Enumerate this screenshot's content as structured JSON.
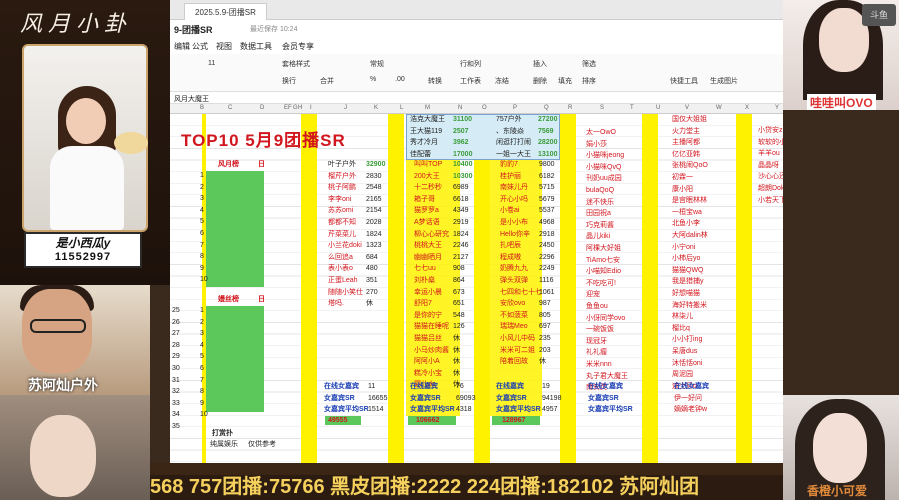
{
  "overlay": {
    "title_art": "风月小卦",
    "streamer_name": "是小西瓜y",
    "streamer_id": "11552997",
    "cam_left_label": "苏阿灿户外",
    "cam_right_label": "哇哇叫OVO",
    "cam_right2_label": "香橙小可爱",
    "corner_badge": "斗鱼",
    "ticker": "568  757团播:75766  黑皮团播:2222  224团播:182102   苏阿灿团"
  },
  "app": {
    "tab_title": "2025.5.9-团播SR",
    "file_name": "9-团播SR",
    "saved_status": "最近保存 10:24",
    "menu": [
      "编辑",
      "公式",
      "视图",
      "数据工具",
      "会员专享"
    ],
    "toolbar": {
      "font_size": "11",
      "items": [
        "套格样式",
        "换行",
        "合并",
        "常规",
        "转换",
        "行和列",
        "工作表",
        "冻结",
        "插入",
        "删除",
        "填充",
        "排序",
        "筛选",
        "快捷工具",
        "生成图片"
      ],
      "percent": "%",
      "decimals": ".00"
    },
    "formula_value": "风月大魔王"
  },
  "sheet": {
    "columns": [
      "B",
      "C",
      "D",
      "E",
      "F",
      "G",
      "H",
      "I",
      "J",
      "K",
      "L",
      "M",
      "N",
      "O",
      "P",
      "Q",
      "R",
      "S",
      "T",
      "U",
      "V",
      "W",
      "X",
      "Y"
    ],
    "title": "TOP10  5月9团播SR",
    "top_box": [
      [
        "浩克大魔王",
        "31100",
        "757户外",
        "27200"
      ],
      [
        "王大猫119",
        "2507",
        "、东陵焱",
        "7569"
      ],
      [
        "秀才冷月",
        "3962",
        "闲逛打打闹",
        "28200"
      ],
      [
        "佳配蕾",
        "17000",
        "一姐一大王",
        "13100"
      ]
    ],
    "section1_label": "风月榜",
    "section1_day": "日",
    "section2_label": "嫚丝榜",
    "section2_day": "日",
    "row_numbers1": [
      "1",
      "2",
      "3",
      "4",
      "5",
      "6",
      "7",
      "8",
      "9",
      "10"
    ],
    "row_numbers2": [
      "1",
      "2",
      "3",
      "4",
      "5",
      "6",
      "7",
      "8",
      "9",
      "10"
    ],
    "row_labels_left": [
      "25",
      "26",
      "27",
      "28",
      "29",
      "30",
      "31",
      "32",
      "33",
      "34",
      "35"
    ],
    "col_j": [
      [
        "叶子户外",
        "32900"
      ],
      [
        "榴芹户外",
        "2830"
      ],
      [
        "桃子阿鹏",
        "2548"
      ],
      [
        "李李oni",
        "2165"
      ],
      [
        "苏苏omi",
        "2154"
      ],
      [
        "都都不知",
        "2028"
      ],
      [
        "芹菜菜儿",
        "1824"
      ],
      [
        "小兰花doki",
        "1323"
      ],
      [
        "么回追a",
        "684"
      ],
      [
        "表小表o",
        "480"
      ],
      [
        "正蛋Leah",
        "351"
      ],
      [
        "随随小笑仕",
        "270"
      ],
      [
        "塔吗.",
        "休"
      ]
    ],
    "col_m": [
      [
        "叫叫TOP",
        "10400"
      ],
      [
        "200大王",
        "10300"
      ],
      [
        "十二秒秒",
        "6989"
      ],
      [
        "箱子哥",
        "6618"
      ],
      [
        "猫罗罗a",
        "4349"
      ],
      [
        "A梦话语",
        "2919"
      ],
      [
        "柳心心研究",
        "1824"
      ],
      [
        "桃桃大王",
        "2246"
      ],
      [
        "幽幽晒月",
        "2127"
      ],
      [
        "七七uu",
        "908"
      ],
      [
        "刘朴燊",
        "864"
      ],
      [
        "幸运小晨",
        "673"
      ],
      [
        "舒阳7",
        "651"
      ],
      [
        "是你的宁",
        "548"
      ],
      [
        "猫猫在睡呢",
        "126"
      ],
      [
        "猫猫吕丝",
        "休"
      ],
      [
        "小马炒肉酱",
        "休"
      ],
      [
        "阿阿小A",
        "休"
      ],
      [
        "糕冷小宝",
        "休"
      ],
      [
        "婴儿dz",
        "休"
      ]
    ],
    "col_p": [
      [
        "豹豹7",
        "9800"
      ],
      [
        "桂护丽",
        "6182"
      ],
      [
        "南妹儿丹",
        "5715"
      ],
      [
        "开心小吗",
        "5679"
      ],
      [
        "小卷ai",
        "5537"
      ],
      [
        "是小小布",
        "4968"
      ],
      [
        "Hello你辛",
        "2918"
      ],
      [
        "扎吧辰",
        "2450"
      ],
      [
        "程成嗷",
        "2296"
      ],
      [
        "奶腾九九",
        "2249"
      ],
      [
        "弹头双弹",
        "1116"
      ],
      [
        "七四和七十七",
        "1061"
      ],
      [
        "安欣ovo",
        "987"
      ],
      [
        "不如菠菜",
        "805"
      ],
      [
        "瑞瑞Meo",
        "697"
      ],
      [
        "小风儿中码",
        "235"
      ],
      [
        "米米可二姐",
        "203"
      ],
      [
        "陪着回故",
        "休"
      ]
    ],
    "col_s": [
      "太一OwO",
      "娟小莎",
      "小猫咪jeong",
      "小猫咪QvQ",
      "刊奶uu成园",
      "bulaQoQ",
      "迷不快乐",
      "田园祝a",
      "巧克莉酱",
      "晶儿kiki",
      "阿棵大好姐",
      "TiAmo七安",
      "小喵知Edio",
      "不吃吃可!",
      "迎宠",
      "鱼鱼ou",
      "小伢同学ovo",
      "一碗饭饭",
      "现冠牙",
      "礼礼瘤",
      "米米nnn",
      "丸子君大魔王",
      "南安灵"
    ],
    "col_v": [
      "国仅大姐姐",
      "火力堂主",
      "主播阿都",
      "亿亿亚韩",
      "张桃闹QoO",
      "初霖一",
      "康小阳",
      "是宫眠林林",
      "一桓宝wa",
      "北鱼小李",
      "大阿dalin林",
      "小宁oni",
      "小柿后yo",
      "猫猫QWQ",
      "我是猎捕y",
      "好想喵猫",
      "海好特搬米",
      "林柒儿",
      "榴比q",
      "小小打ing",
      "呆唐dus",
      "沐恬恬oni",
      "周泥园",
      "迪士尼o"
    ],
    "col_y": [
      "小贷安zme",
      "软软的小罗",
      "羊羊ou",
      "晶晶呀",
      "沙心心还猫",
      "超朗Doki",
      "小若天下第一"
    ],
    "summary_rows": [
      [
        "在线女嘉宾",
        "11",
        "在线嘉宾",
        "76",
        "在线嘉宾",
        "19",
        "在线女嘉宾",
        "在线女嘉宾"
      ],
      [
        "女嘉宾SR",
        "16655",
        "女嘉宾SR",
        "69093",
        "女嘉宾SR",
        "94198",
        "女嘉宾SR",
        "伊一好问"
      ],
      [
        "女嘉宾平均SR",
        "1514",
        "女嘉宾平均SR",
        "4318",
        "女嘉宾平均SR",
        "4957",
        "女嘉宾平均SR",
        "嫡嫡老钟w"
      ]
    ],
    "totals": [
      "49555",
      "106662",
      "128967"
    ],
    "footer_notes": [
      "打赏扑",
      "纯属娱乐",
      "仅供参考"
    ]
  },
  "colors": {
    "accent_red": "#d2161e",
    "highlight_yellow": "#fff200",
    "cell_green": "#5cc85c",
    "ticker_text": "#f5d05c"
  }
}
